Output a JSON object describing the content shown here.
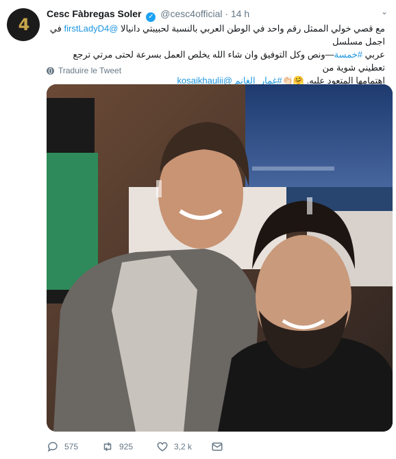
{
  "author": {
    "name": "Cesc Fàbregas Soler",
    "handle": "@cesc4official",
    "separator": "·",
    "time": "14 h",
    "avatar_text": "4"
  },
  "tweet": {
    "line1_text": "مع قصي خولي الممثل رقم واحد في الوطن العربي  بالنسبة لحبيبتي دانيالا ",
    "line1_link": "@firstLadyD4",
    "line1_end": " في اجمل مسلسل",
    "line2_start": "عربي ",
    "line2_tag": "#خمسة",
    "line2_rest": "—ونص وكل التوفيق  وان شاء الله يخلص العمل بسرعة لحتى مرتي ترجع تعطيني شوية من",
    "line3_start": "اهتمامها المتعود عليه. 🤗👏🏻",
    "line3_tag": "#غمار_الغانم",
    "line3_link": "@kosaikhaulii"
  },
  "translate_label": "Traduire le Tweet",
  "actions": {
    "reply_count": "575",
    "retweet_count": "925",
    "like_count": "3,2 k"
  },
  "icons": {
    "verified": "verified-badge-icon",
    "reply": "reply-icon",
    "retweet": "retweet-icon",
    "like": "heart-icon",
    "dm": "envelope-icon",
    "globe": "globe-icon",
    "menu": "chevron-down-icon"
  },
  "colors": {
    "link": "#1b95e0",
    "verified": "#1da1f2",
    "muted": "#657786"
  }
}
